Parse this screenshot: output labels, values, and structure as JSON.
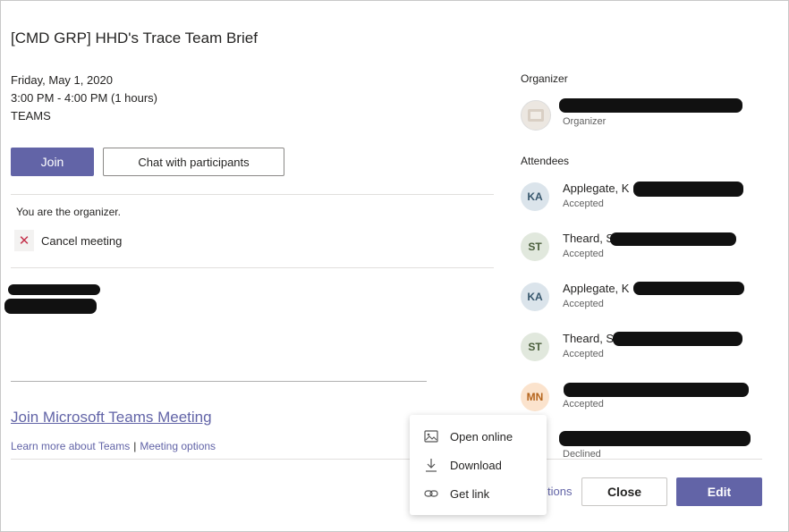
{
  "meeting": {
    "title": "[CMD GRP] HHD's Trace Team Brief",
    "date": "Friday, May 1, 2020",
    "time": "3:00 PM - 4:00 PM (1 hours)",
    "location": "TEAMS"
  },
  "actions": {
    "join_label": "Join",
    "chat_label": "Chat with participants",
    "organizer_note": "You are the organizer.",
    "cancel_label": "Cancel meeting"
  },
  "links": {
    "join_teams": "Join Microsoft Teams Meeting",
    "learn_more": "Learn more about Teams",
    "separator": "|",
    "meeting_options": "Meeting options"
  },
  "people": {
    "organizer_heading": "Organizer",
    "organizer_role": "Organizer",
    "attendees_heading": "Attendees",
    "attendees": [
      {
        "initials": "KA",
        "name": "Applegate, K",
        "status": "Accepted"
      },
      {
        "initials": "ST",
        "name": "Theard, S",
        "status": "Accepted"
      },
      {
        "initials": "KA",
        "name": "Applegate, K",
        "status": "Accepted"
      },
      {
        "initials": "ST",
        "name": "Theard, S",
        "status": "Accepted"
      },
      {
        "initials": "MN",
        "name": "",
        "status": "Accepted"
      },
      {
        "initials": "",
        "name": "",
        "status": "Declined"
      }
    ]
  },
  "footer": {
    "options_fragment": "tions",
    "close_label": "Close",
    "edit_label": "Edit"
  },
  "context_menu": {
    "items": [
      {
        "label": "Open online",
        "icon": "open-online-icon"
      },
      {
        "label": "Download",
        "icon": "download-icon"
      },
      {
        "label": "Get link",
        "icon": "link-icon"
      }
    ]
  },
  "colors": {
    "accent": "#6264a7",
    "cancel_red": "#c4314b"
  }
}
